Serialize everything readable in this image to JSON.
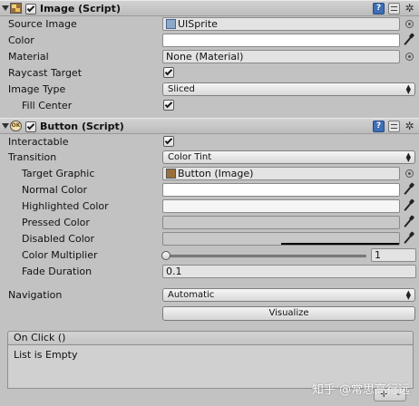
{
  "image_component": {
    "title": "Image (Script)",
    "enabled": true,
    "fields": {
      "source_image": {
        "label": "Source Image",
        "value": "UISprite"
      },
      "color": {
        "label": "Color",
        "value": ""
      },
      "material": {
        "label": "Material",
        "value": "None (Material)"
      },
      "raycast_target": {
        "label": "Raycast Target",
        "checked": true
      },
      "image_type": {
        "label": "Image Type",
        "value": "Sliced"
      },
      "fill_center": {
        "label": "Fill Center",
        "checked": true
      }
    }
  },
  "button_component": {
    "title": "Button (Script)",
    "icon_text": "OK",
    "enabled": true,
    "fields": {
      "interactable": {
        "label": "Interactable",
        "checked": true
      },
      "transition": {
        "label": "Transition",
        "value": "Color Tint"
      },
      "target_graphic": {
        "label": "Target Graphic",
        "value": "Button (Image)"
      },
      "normal_color": {
        "label": "Normal Color",
        "color": "#ffffff"
      },
      "highlighted_color": {
        "label": "Highlighted Color",
        "color": "#f5f5f5"
      },
      "pressed_color": {
        "label": "Pressed Color",
        "color": "#c8c8c8"
      },
      "disabled_color": {
        "label": "Disabled Color",
        "color": "#c8c8c8",
        "alpha_bar_fraction": 0.5
      },
      "color_multiplier": {
        "label": "Color Multiplier",
        "value": "1",
        "slider_fraction": 0.0
      },
      "fade_duration": {
        "label": "Fade Duration",
        "value": "0.1"
      }
    },
    "navigation": {
      "label": "Navigation",
      "value": "Automatic"
    },
    "visualize_label": "Visualize",
    "on_click": {
      "header": "On Click ()",
      "empty_text": "List is Empty",
      "add_symbol": "+",
      "remove_symbol": "-"
    }
  },
  "header_icons": {
    "help": "help-book-icon",
    "presets": "preset-sliders-icon",
    "settings": "gear-icon"
  },
  "gear_glyph": "✲",
  "book_glyph": "?",
  "watermark": "知乎 @常思高行远"
}
